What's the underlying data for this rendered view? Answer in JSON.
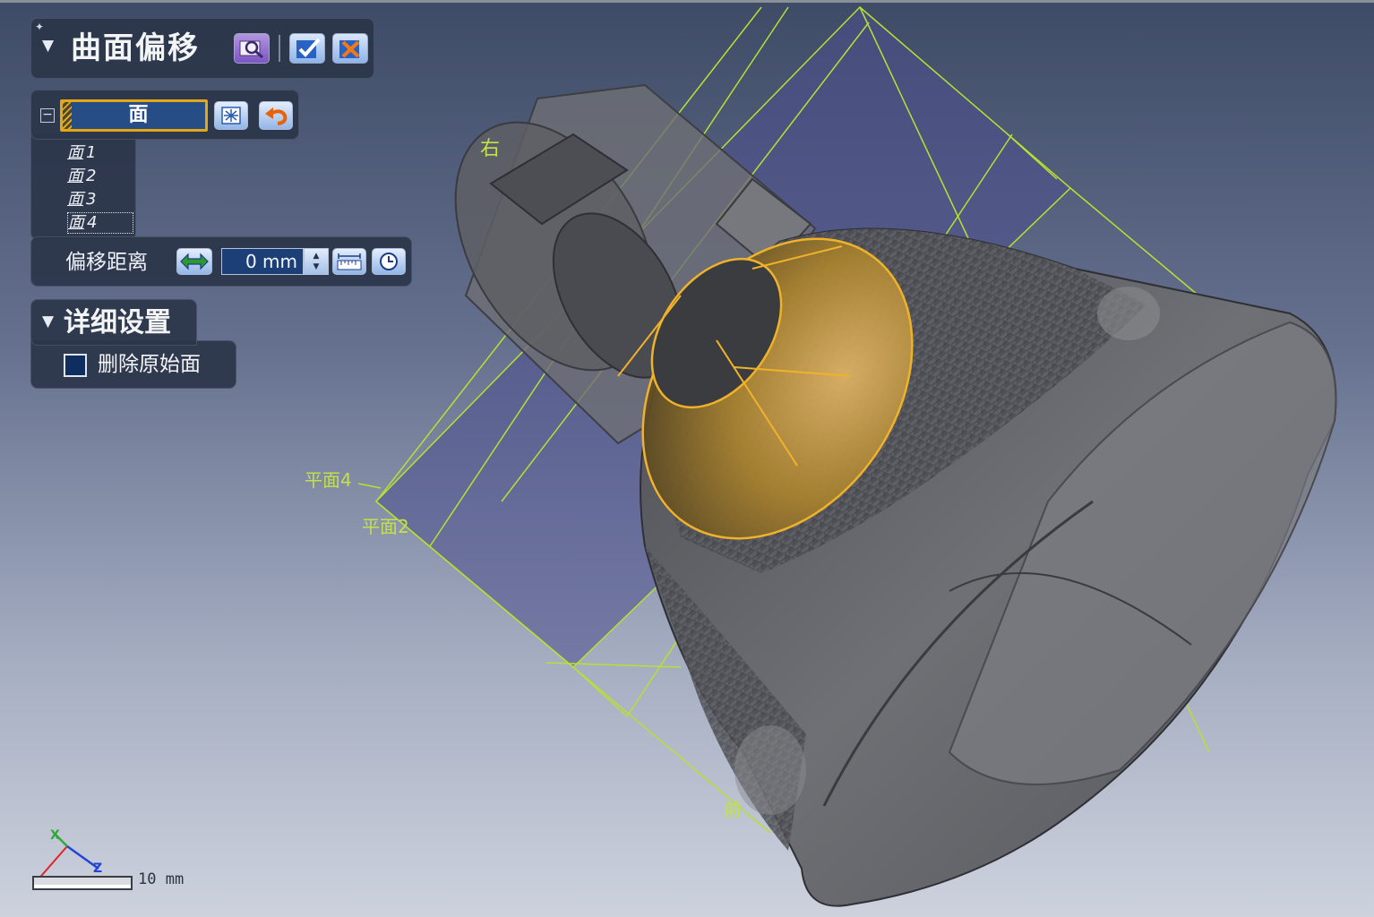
{
  "command_panel": {
    "title": "曲面偏移",
    "preview_icon": "preview-magnifier-icon",
    "ok_icon": "checkmark-icon",
    "cancel_icon": "close-x-icon"
  },
  "face_selector": {
    "label": "面",
    "select_all_icon": "select-all-icon",
    "undo_icon": "undo-arrow-icon",
    "items": [
      {
        "glyph": "面",
        "number": "1"
      },
      {
        "glyph": "面",
        "number": "2"
      },
      {
        "glyph": "面",
        "number": "3"
      },
      {
        "glyph": "面",
        "number": "4"
      }
    ]
  },
  "offset_distance": {
    "label": "偏移距离",
    "value": "0 mm",
    "flip_icon": "flip-direction-icon",
    "measure_icon": "measure-icon",
    "reset_icon": "reset-icon"
  },
  "details": {
    "title": "详细设置",
    "delete_original_label": "删除原始面",
    "delete_original_checked": false
  },
  "viewport": {
    "labels": {
      "right": "右",
      "plane4": "平面4",
      "plane2": "平面2",
      "front": "前"
    },
    "axis_labels": {
      "x": "X",
      "z": "Z"
    },
    "scale": "10  mm",
    "colors": {
      "plane_lines": "#b8e032",
      "selection": "#e6a21a",
      "model": "#6d6e72"
    }
  }
}
